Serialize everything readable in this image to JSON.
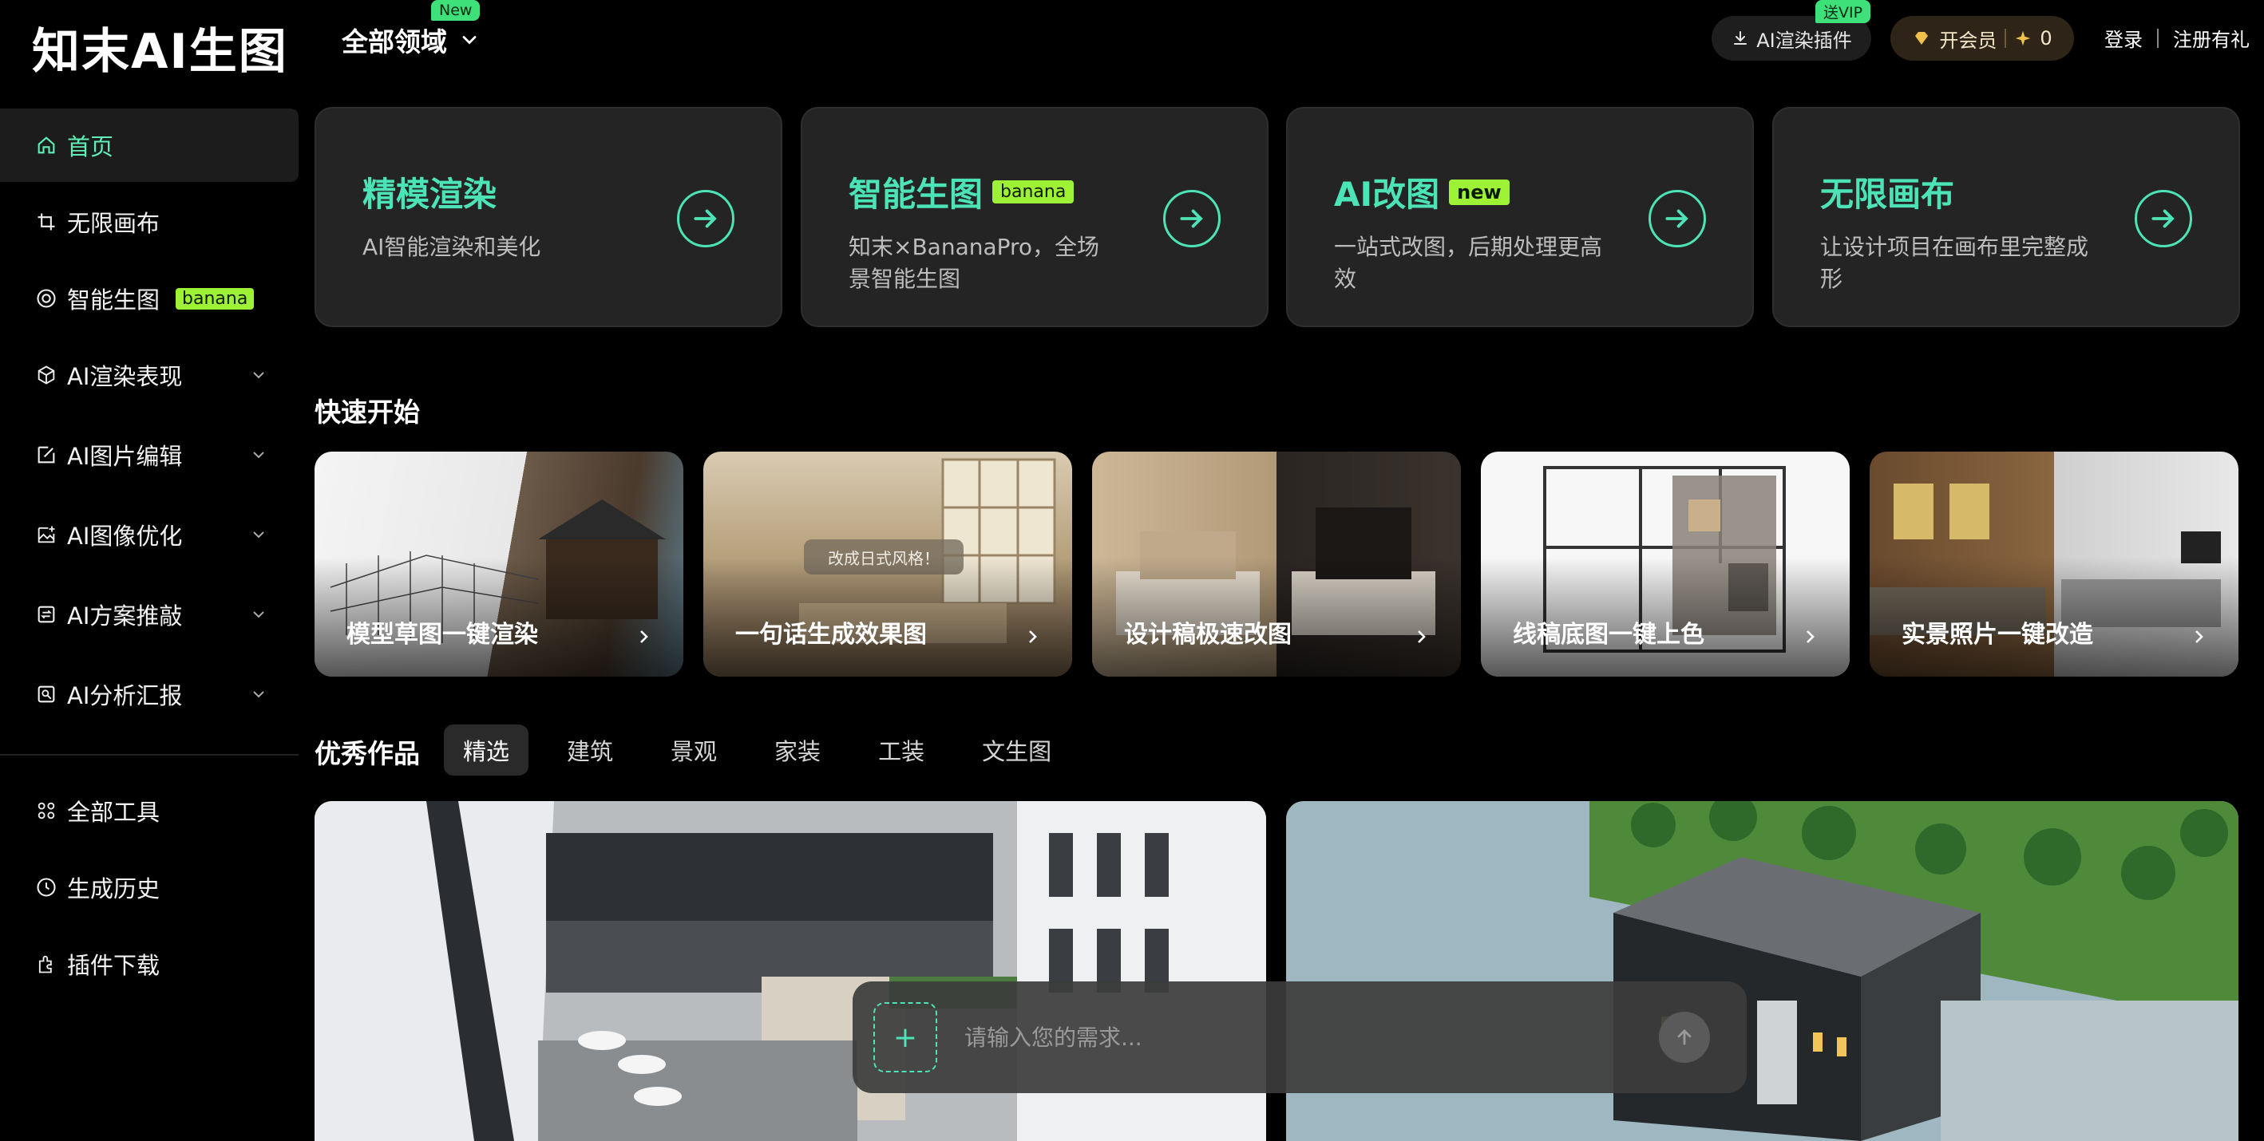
{
  "header": {
    "logo": "知末AI生图",
    "domain_label": "全部领域",
    "domain_badge": "New",
    "plugin_label": "AI渲染插件",
    "plugin_badge": "送VIP",
    "vip_label": "开会员",
    "points": "0",
    "login": "登录",
    "register": "注册有礼"
  },
  "sidebar": {
    "items": [
      {
        "label": "首页",
        "icon": "home-icon",
        "active": true
      },
      {
        "label": "无限画布",
        "icon": "crop-icon"
      },
      {
        "label": "智能生图",
        "icon": "aperture-icon",
        "tag": "banana"
      },
      {
        "label": "AI渲染表现",
        "icon": "cube-icon",
        "expandable": true
      },
      {
        "label": "AI图片编辑",
        "icon": "edit-icon",
        "expandable": true
      },
      {
        "label": "AI图像优化",
        "icon": "image-enhance-icon",
        "expandable": true
      },
      {
        "label": "AI方案推敲",
        "icon": "compare-icon",
        "expandable": true
      },
      {
        "label": "AI分析汇报",
        "icon": "report-icon",
        "expandable": true
      }
    ],
    "bottom": [
      {
        "label": "全部工具",
        "icon": "grid-icon"
      },
      {
        "label": "生成历史",
        "icon": "clock-icon"
      },
      {
        "label": "插件下载",
        "icon": "plugin-icon"
      }
    ]
  },
  "feature_cards": [
    {
      "title": "精模渲染",
      "desc": "AI智能渲染和美化",
      "tag": ""
    },
    {
      "title": "智能生图",
      "desc": "知末×BananaPro，全场景智能生图",
      "tag": "banana"
    },
    {
      "title": "AI改图",
      "desc": "一站式改图，后期处理更高效",
      "tag": "new"
    },
    {
      "title": "无限画布",
      "desc": "让设计项目在画布里完整成形",
      "tag": ""
    }
  ],
  "quick_start": {
    "title": "快速开始",
    "items": [
      {
        "label": "模型草图一键渲染"
      },
      {
        "label": "一句话生成效果图",
        "overlay": "改成日式风格！"
      },
      {
        "label": "设计稿极速改图"
      },
      {
        "label": "线稿底图一键上色"
      },
      {
        "label": "实景照片一键改造"
      }
    ]
  },
  "works": {
    "title": "优秀作品",
    "tabs": [
      "精选",
      "建筑",
      "景观",
      "家装",
      "工装",
      "文生图"
    ],
    "active_tab": "精选"
  },
  "prompt": {
    "placeholder": "请输入您的需求..."
  },
  "colors": {
    "accent": "#4ce4b6",
    "badge_green": "#3ee07a",
    "banana": "#9ef236"
  }
}
